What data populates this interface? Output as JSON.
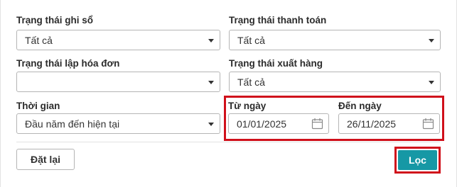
{
  "filters": {
    "posting_status": {
      "label": "Trạng thái ghi sổ",
      "value": "Tất cả"
    },
    "payment_status": {
      "label": "Trạng thái thanh toán",
      "value": "Tất cả"
    },
    "invoice_status": {
      "label": "Trạng thái lập hóa đơn",
      "value": ""
    },
    "shipping_status": {
      "label": "Trạng thái xuất hàng",
      "value": "Tất cả"
    },
    "period": {
      "label": "Thời gian",
      "value": "Đầu năm đến hiện tại"
    },
    "from_date": {
      "label": "Từ ngày",
      "value": "01/01/2025"
    },
    "to_date": {
      "label": "Đến ngày",
      "value": "26/11/2025"
    }
  },
  "actions": {
    "reset_label": "Đặt lại",
    "filter_label": "Lọc"
  },
  "icons": {
    "dropdown": "chevron-down-icon",
    "calendar": "calendar-icon"
  },
  "colors": {
    "primary_button": "#1698a5",
    "highlight_border": "#d0101b"
  }
}
